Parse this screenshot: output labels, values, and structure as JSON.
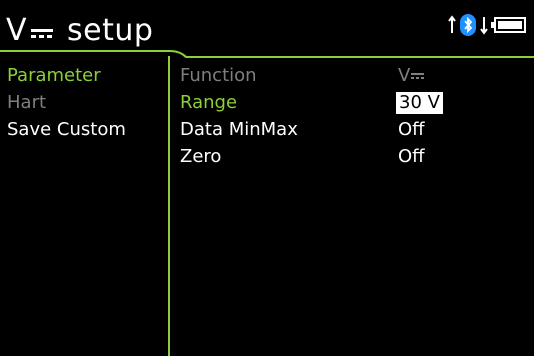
{
  "header": {
    "mode": "V",
    "mode_icon": "dc-symbol",
    "title": "setup"
  },
  "status": {
    "icons": [
      "arrow-up-icon",
      "bluetooth-icon",
      "arrow-down-icon",
      "battery-icon"
    ],
    "battery_level": 1.0,
    "bluetooth_color": "#1e90ff"
  },
  "sidebar": {
    "items": [
      {
        "label": "Parameter",
        "state": "active"
      },
      {
        "label": "Hart",
        "state": "disabled"
      },
      {
        "label": "Save Custom",
        "state": "normal"
      }
    ]
  },
  "parameters": [
    {
      "label": "Function",
      "value": "V",
      "value_icon": "dc-symbol",
      "state": "dim"
    },
    {
      "label": "Range",
      "value": "30 V",
      "state": "active",
      "selected": true
    },
    {
      "label": "Data MinMax",
      "value": "Off",
      "state": "normal"
    },
    {
      "label": "Zero",
      "value": "Off",
      "state": "normal"
    }
  ],
  "colors": {
    "accent": "#8ccf3a",
    "disabled": "#7f7f7f",
    "background": "#000000",
    "text": "#ffffff"
  }
}
